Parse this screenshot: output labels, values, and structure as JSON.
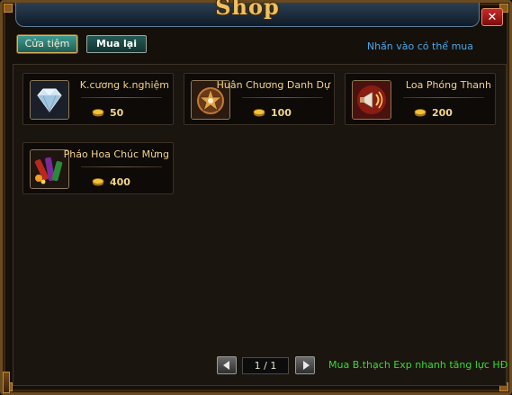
{
  "window": {
    "title": "Shop",
    "close_label": "✕"
  },
  "tabs": [
    {
      "label": "Cửa tiệm",
      "active": true
    },
    {
      "label": "Mua lại",
      "active": false
    }
  ],
  "hint": "Nhấn vào có thể mua",
  "items": [
    {
      "name": "K.cương k.nghiệm",
      "price": "50",
      "icon": "diamond-icon"
    },
    {
      "name": "Huân Chương Danh Dự",
      "price": "100",
      "icon": "medal-star-icon"
    },
    {
      "name": "Loa Phóng Thanh",
      "price": "200",
      "icon": "megaphone-icon"
    },
    {
      "name": "Pháo Hoa Chúc Mừng",
      "price": "400",
      "icon": "firework-icon"
    }
  ],
  "currency_icon": "gold-coin-icon",
  "pager": {
    "label": "1 / 1"
  },
  "promo_link": "Mua B.thạch Exp nhanh tăng lực HĐ",
  "colors": {
    "accent_gold": "#f2d489",
    "hint_blue": "#46a8ea",
    "promo_green": "#36dc2e"
  }
}
